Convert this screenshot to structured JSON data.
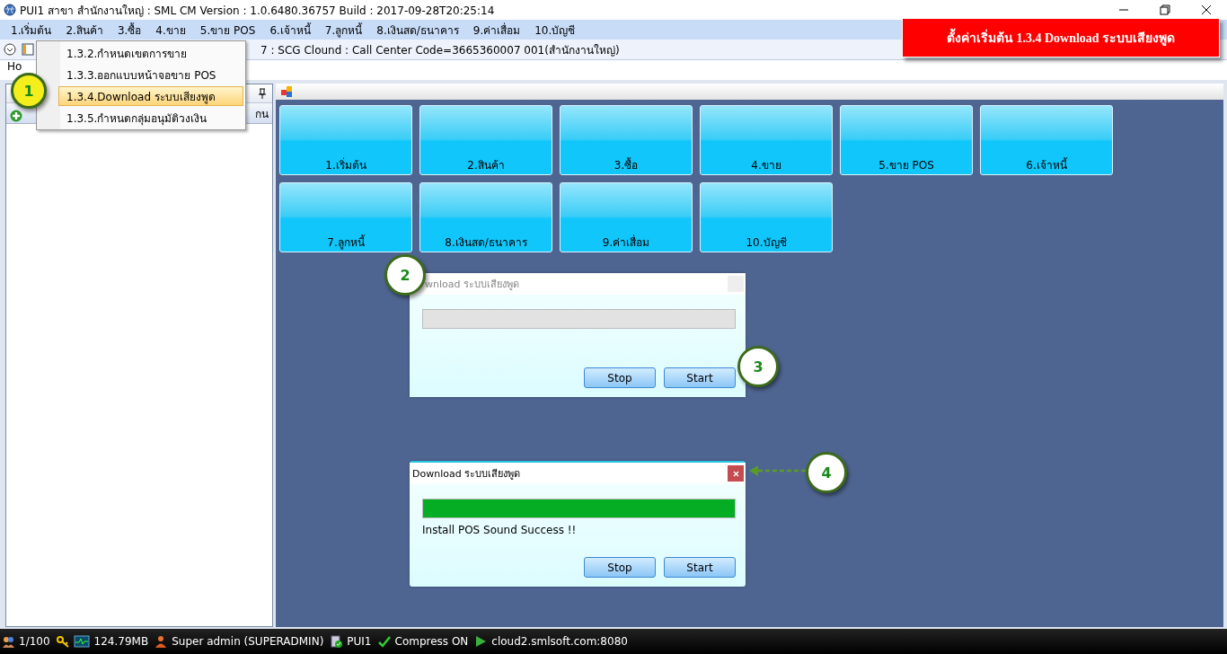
{
  "window": {
    "title": "PUI1 สาขา สำนักงานใหญ่ : SML CM Version : 1.0.6480.36757  Build : 2017-09-28T20:25:14"
  },
  "menu_bar": {
    "items": [
      {
        "label": "1.เริ่มต้น"
      },
      {
        "label": "2.สินค้า"
      },
      {
        "label": "3.ซื้อ"
      },
      {
        "label": "4.ขาย"
      },
      {
        "label": "5.ขาย POS"
      },
      {
        "label": "6.เจ้าหนี้"
      },
      {
        "label": "7.ลูกหนี้"
      },
      {
        "label": "8.เงินสด/ธนาคาร"
      },
      {
        "label": "9.ค่าเสื่อม"
      },
      {
        "label": "10.บัญชี"
      }
    ]
  },
  "toolbar": {
    "info": "7 : SCG Clound : Call Center Code=3665360007 001(สำนักงานใหญ่)"
  },
  "tab": {
    "label": "Ho"
  },
  "dropdown": {
    "items": [
      {
        "label": "1.3.2.กำหนดเขตการขาย",
        "selected": false
      },
      {
        "label": "1.3.3.ออกแบบหน้าจอขาย POS",
        "selected": false
      },
      {
        "label": "1.3.4.Download ระบบเสียงพูด",
        "selected": true
      },
      {
        "label": "1.3.5.กำหนดกลุ่มอนุมัติวงเงิน",
        "selected": false
      }
    ]
  },
  "banner": {
    "text": "ตั้งค่าเริ่มต้น  1.3.4  Download ระบบเสียงพูด"
  },
  "left_panel": {
    "tool_label": "กน"
  },
  "tiles": [
    {
      "label": "1.เริ่มต้น"
    },
    {
      "label": "2.สินค้า"
    },
    {
      "label": "3.ซื้อ"
    },
    {
      "label": "4.ขาย"
    },
    {
      "label": "5.ขาย POS"
    },
    {
      "label": "6.เจ้าหนี้"
    },
    {
      "label": "7.ลูกหนี้"
    },
    {
      "label": "8.เงินสด/ธนาคาร"
    },
    {
      "label": "9.ค่าเสื่อม"
    },
    {
      "label": "10.บัญชี"
    }
  ],
  "dialogs": [
    {
      "title": "wnload ระบบเสียงพูด",
      "active": false,
      "level": 0,
      "buttons": [
        "Stop",
        "Start"
      ]
    },
    {
      "title": "Download ระบบเสียงพูด",
      "active": true,
      "level": 1,
      "message": "Install POS Sound Success !!",
      "buttons": [
        "Stop",
        "Start"
      ]
    }
  ],
  "callouts": [
    {
      "number": "1",
      "color": "#f4ee1c"
    },
    {
      "number": "2",
      "color": "#ffffff"
    },
    {
      "number": "3",
      "color": "#ffffff"
    },
    {
      "number": "4",
      "color": "#ffffff"
    }
  ],
  "status_bar": {
    "items": [
      {
        "kind": "users",
        "text": "1/100"
      },
      {
        "kind": "memory",
        "text": "124.79MB"
      },
      {
        "kind": "user",
        "text": "Super admin (SUPERADMIN)"
      },
      {
        "kind": "database",
        "text": "PUI1"
      },
      {
        "kind": "check",
        "text": "Compress ON"
      },
      {
        "kind": "play",
        "text": "cloud2.smlsoft.com:8080"
      }
    ]
  }
}
